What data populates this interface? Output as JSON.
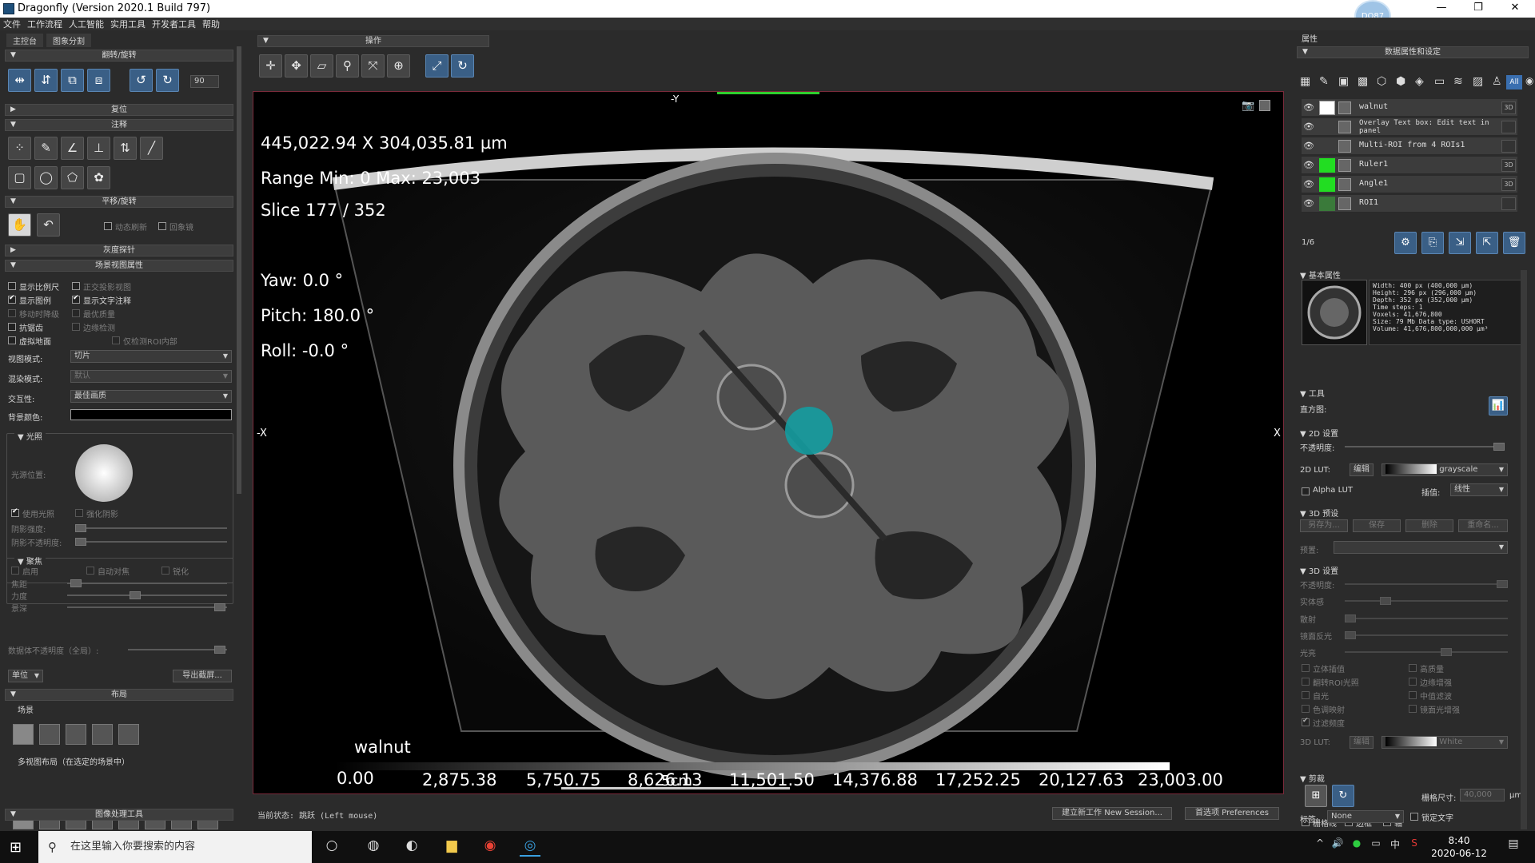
{
  "window": {
    "title": "Dragonfly (Version 2020.1 Build 797)",
    "avatar": "DO87",
    "minimize": "—",
    "restore": "❐",
    "close": "✕"
  },
  "menu": [
    "文件",
    "工作流程",
    "人工智能",
    "实用工具",
    "开发者工具",
    "帮助"
  ],
  "left": {
    "tabs": [
      "主控台",
      "图象分割"
    ],
    "sections": {
      "flip": "翻转/旋转",
      "reset": "复位",
      "annot": "注释",
      "pan": "平移/旋转",
      "gray": "灰度探针",
      "scene": "场景视图属性",
      "layout": "布局",
      "imgtools": "图像处理工具"
    },
    "rotate_value": "90",
    "dyn_refresh": "动态刷新",
    "lock_views": "回象镜",
    "scene_checks": [
      {
        "label": "显示比例尺",
        "on": false
      },
      {
        "label": "正交投影视图",
        "on": false,
        "dim": true
      },
      {
        "label": "显示图例",
        "on": true
      },
      {
        "label": "显示文字注释",
        "on": true
      },
      {
        "label": "移动时降级",
        "on": false,
        "dim": true
      },
      {
        "label": "最优质量",
        "on": false,
        "dim": true
      },
      {
        "label": "抗锯齿",
        "on": false
      },
      {
        "label": "边缘检测",
        "on": false,
        "dim": true
      },
      {
        "label": "虚拟地面",
        "on": false
      },
      {
        "label": "仅检测ROI内部",
        "on": false,
        "dim": true
      }
    ],
    "view_mode_label": "视图模式:",
    "view_mode": "切片",
    "blend_label": "混染模式:",
    "blend": "默认",
    "interp_label": "交互性:",
    "interp": "最佳画质",
    "bg_label": "背景颜色:",
    "light_title": "光照",
    "light_pos": "光源位置:",
    "use_light": "使用光照",
    "enhance_shadow": "强化阴影",
    "shadow_strength": "阴影强度:",
    "shadow_opacity": "阴影不透明度:",
    "focus_title": "聚焦",
    "focus_enable": "启用",
    "auto_focus": "自动对焦",
    "sharp": "锐化",
    "focus_dist": "焦距",
    "focus_strength": "力度",
    "depth": "景深",
    "opacity_all": "数据体不透明度（全局）:",
    "unit": "单位",
    "export_screen": "导出截屏...",
    "scene_label": "场景",
    "multi_layout": "多视图布局（在选定的场景中）"
  },
  "toolbar": {
    "title": "操作"
  },
  "viewport": {
    "axis_top": "-Y",
    "axis_left": "-X",
    "axis_right": "X",
    "coords": "445,022.94 X 304,035.81 µm",
    "range": "Range Min: 0 Max: 23,003",
    "slice": "Slice 177 / 352",
    "yaw": "Yaw: 0.0 °",
    "pitch": "Pitch: 180.0 °",
    "roll": "Roll: -0.0 °",
    "legend_name": "walnut",
    "legend_ticks": [
      "0.00",
      "2,875.38",
      "5,750.75",
      "8,626.13",
      "11,501.50",
      "14,376.88",
      "17,252.25",
      "20,127.63",
      "23,003.00"
    ],
    "scale_label": "5cm"
  },
  "status": {
    "state": "当前状态: 跳跃 (Left mouse)",
    "new_session": "建立新工作 New Session...",
    "preferences": "首选项 Preferences"
  },
  "right": {
    "props": "属性",
    "data_props": "数据属性和设定",
    "all": "All",
    "layers": [
      {
        "name": "walnut",
        "swatch": "#ffffff",
        "d": "3D"
      },
      {
        "name": "Overlay Text box: Edit text in panel",
        "swatch": "",
        "d": ""
      },
      {
        "name": "Multi-ROI from 4 ROIs1",
        "swatch": "",
        "d": ""
      },
      {
        "name": "Ruler1",
        "swatch": "#22dd22",
        "d": "3D"
      },
      {
        "name": "Angle1",
        "swatch": "#22dd22",
        "d": "3D"
      },
      {
        "name": "ROI1",
        "swatch": "#3a7a3a",
        "d": ""
      }
    ],
    "count": "1/6",
    "basic": "基本属性",
    "info": [
      "Width: 400 px (400,000 µm)",
      "Height: 296 px (296,000 µm)",
      "Depth: 352 px (352,000 µm)",
      "Time steps: 1",
      "Voxels: 41,676,800",
      "Size: 79 Mb  Data type: USHORT",
      "Volume: 41,676,800,000,000 µm³"
    ],
    "tools": "工具",
    "histogram": "直方图:",
    "set2d": "2D 设置",
    "opacity": "不透明度:",
    "lut2d": "2D LUT:",
    "edit": "编辑",
    "grayscale": "grayscale",
    "alpha_lut": "Alpha LUT",
    "interp": "插值:",
    "interp_val": "线性",
    "preset3d": "3D 预设",
    "save_as": "另存为...",
    "save": "保存",
    "delete": "删除",
    "rename": "重命名...",
    "preset": "预置:",
    "set3d": "3D 设置",
    "opacity3d": "不透明度:",
    "solid": "实体感",
    "scatter": "散射",
    "back_reflect": "镜面反光",
    "ambient": "光亮",
    "opts": [
      [
        "立体插值",
        "高质量"
      ],
      [
        "翻转ROI光照",
        "边缘增强"
      ],
      [
        "自光",
        "中值滤波"
      ],
      [
        "色调映射",
        "镜面光增强"
      ],
      [
        "过滤频度",
        ""
      ]
    ],
    "lut3d": "3D LUT:",
    "white": "White",
    "clip": "剪裁",
    "grid_size": "栅格尺寸:",
    "grid_val": "40,000",
    "um": "µm",
    "gridline": "栅格线",
    "border": "边框",
    "axis": "轴",
    "label": "标签:",
    "none": "None",
    "lock_text": "锁定文字"
  },
  "taskbar": {
    "search": "在这里输入你要搜索的内容",
    "time": "8:40",
    "date": "2020-06-12",
    "ime": "中"
  }
}
